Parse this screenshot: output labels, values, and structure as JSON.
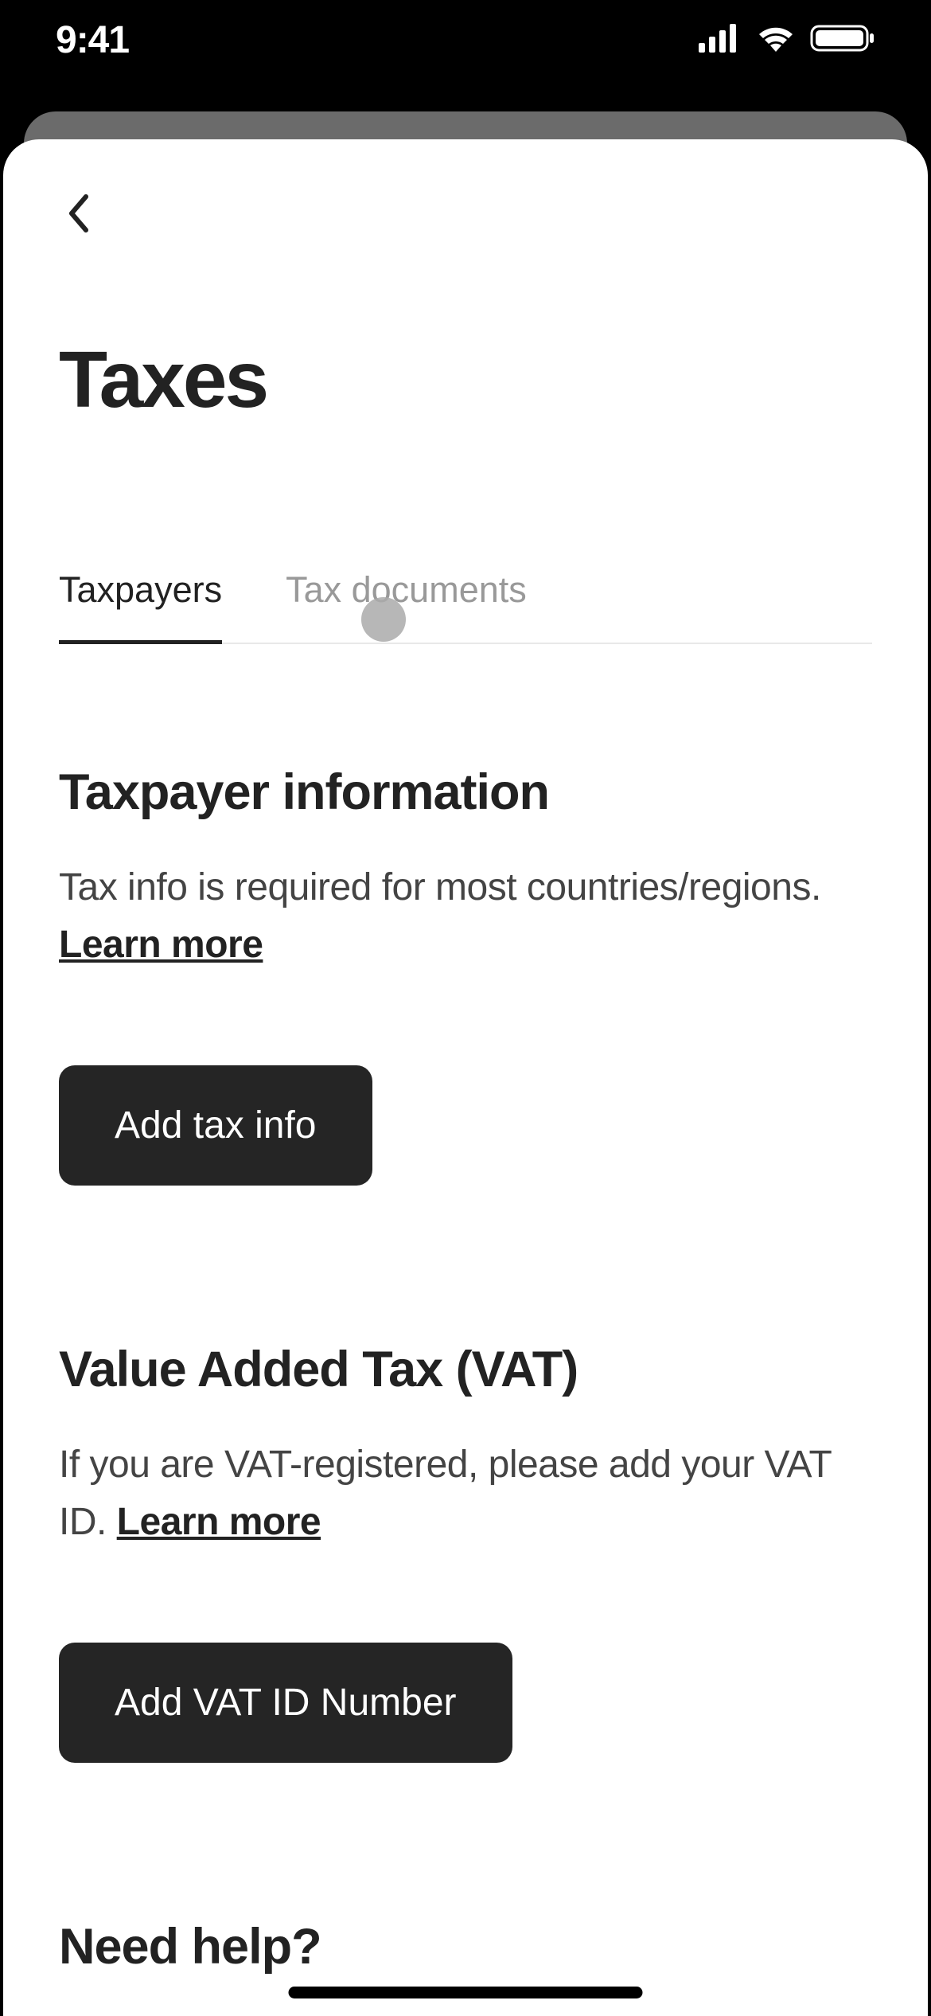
{
  "statusBar": {
    "time": "9:41"
  },
  "page": {
    "title": "Taxes"
  },
  "tabs": [
    {
      "label": "Taxpayers",
      "active": true
    },
    {
      "label": "Tax documents",
      "active": false
    }
  ],
  "sections": {
    "taxpayer": {
      "title": "Taxpayer information",
      "text": "Tax info is required for most countries/regions. ",
      "learnMore": "Learn more",
      "button": "Add tax info"
    },
    "vat": {
      "title": "Value Added Tax (VAT)",
      "text": "If you are VAT-registered, please add your VAT ID. ",
      "learnMore": "Learn more",
      "button": "Add VAT ID Number"
    },
    "help": {
      "title": "Need help?"
    }
  }
}
